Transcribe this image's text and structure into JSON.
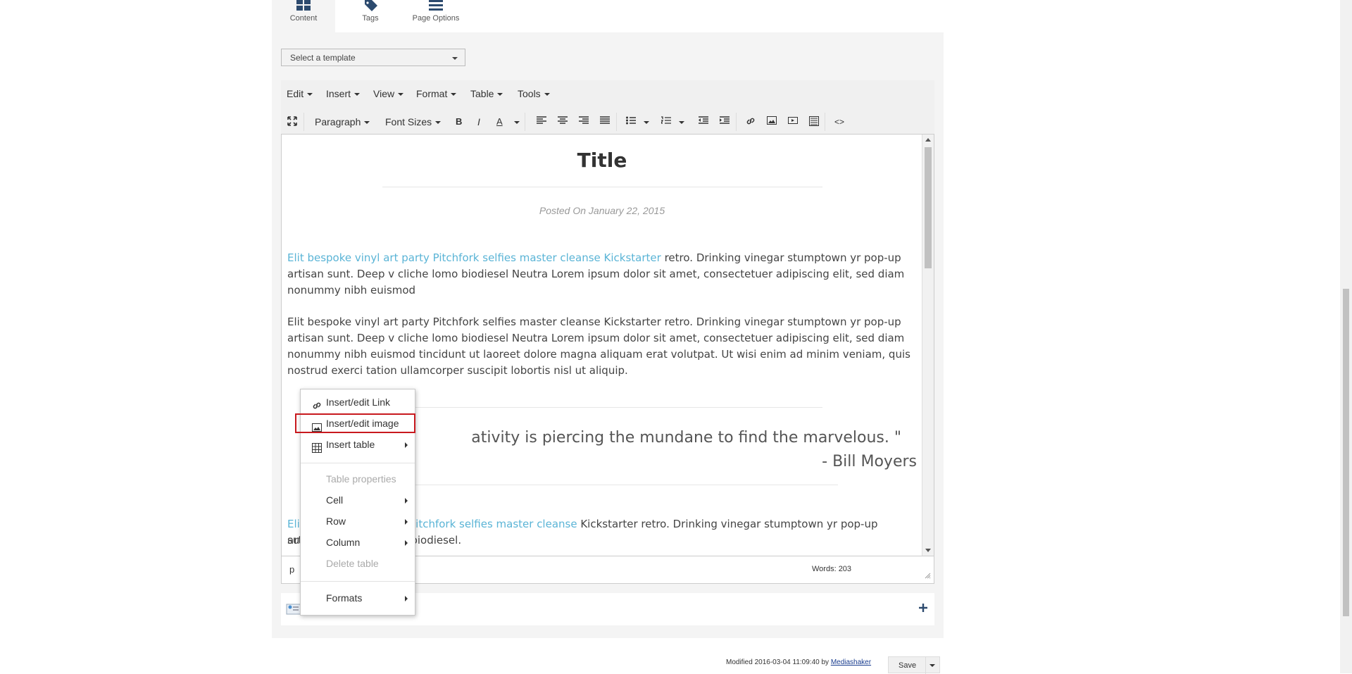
{
  "tabs": [
    {
      "label": "Content",
      "icon": "grid-icon"
    },
    {
      "label": "Tags",
      "icon": "tag-icon"
    },
    {
      "label": "Page Options",
      "icon": "menu-icon"
    }
  ],
  "template_select": {
    "value": "Select a template"
  },
  "menubar": [
    "Edit",
    "Insert",
    "View",
    "Format",
    "Table",
    "Tools"
  ],
  "toolbar": {
    "paragraph": "Paragraph",
    "font_sizes": "Font Sizes",
    "bold": "B",
    "italic": "I",
    "text_color": "A",
    "code": "<>"
  },
  "document": {
    "title": "Title",
    "posted": "Posted On January 22, 2015",
    "para1_link": "Elit bespoke vinyl art party Pitchfork selfies master cleanse Kickstarter",
    "para1_rest": " retro. Drinking vinegar stumptown yr pop-up artisan sunt. Deep v cliche lomo biodiesel Neutra Lorem ipsum dolor sit amet, consectetuer adipiscing elit, sed diam nonummy nibh euismod",
    "para2": "Elit bespoke vinyl art party Pitchfork selfies master cleanse Kickstarter retro. Drinking vinegar stumptown yr pop-up artisan sunt. Deep v cliche lomo biodiesel Neutra Lorem ipsum dolor sit amet, consectetuer adipiscing elit, sed diam nonummy nibh euismod tincidunt ut laoreet dolore magna aliquam erat volutpat. Ut wisi enim ad minim veniam, quis nostrud exerci tation ullamcorper suscipit lobortis nisl ut aliquip.",
    "quote": "ativity is piercing the mundane to find the marvelous. \"",
    "quote_author": "- Bill Moyers",
    "para3_link": "y Pitchfork selfies master cleanse",
    "para3_link_start": "Eli",
    "para3_rest": " Kickstarter retro. Drinking vinegar stumptown yr pop-up artisan",
    "para3_line2_start": "su",
    "para3_line2_rest": "biodiesel."
  },
  "statusbar": {
    "path": "p",
    "words": "Words: 203"
  },
  "context_menu": {
    "items": [
      {
        "label": "Insert/edit Link",
        "icon": "link-icon",
        "enabled": true,
        "submenu": false
      },
      {
        "label": "Insert/edit image",
        "icon": "image-icon",
        "enabled": true,
        "submenu": false
      },
      {
        "label": "Insert table",
        "icon": "table-icon",
        "enabled": true,
        "submenu": true
      },
      {
        "label": "Table properties",
        "enabled": false,
        "submenu": false
      },
      {
        "label": "Cell",
        "enabled": true,
        "submenu": true
      },
      {
        "label": "Row",
        "enabled": true,
        "submenu": true
      },
      {
        "label": "Column",
        "enabled": true,
        "submenu": true
      },
      {
        "label": "Delete table",
        "enabled": false,
        "submenu": false
      },
      {
        "label": "Formats",
        "enabled": true,
        "submenu": true
      }
    ]
  },
  "addbar": {
    "partial_text": "t",
    "add_icon": "plus-icon"
  },
  "footer": {
    "modified": "Modified 2016-03-04 11:09:40 by",
    "user": "Mediashaker",
    "save_label": "Save"
  },
  "colors": {
    "highlight": "#c8191e",
    "link": "#5ab4d6"
  }
}
